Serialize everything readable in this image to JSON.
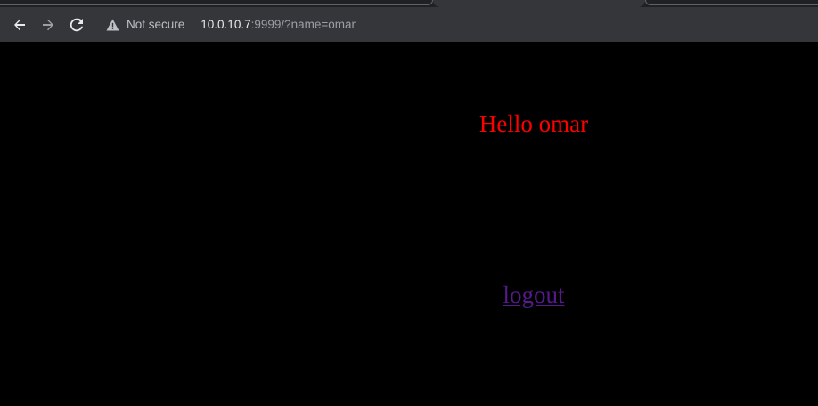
{
  "browser": {
    "security_label": "Not secure",
    "url_host": "10.0.10.7",
    "url_rest": ":9999/?name=omar",
    "icons": [
      "back-arrow-icon",
      "forward-arrow-icon",
      "reload-icon",
      "warning-icon"
    ]
  },
  "page": {
    "greeting": "Hello omar",
    "logout_label": "logout",
    "colors": {
      "background": "#000000",
      "greeting": "#ff0000",
      "link_visited": "#551a8b"
    }
  }
}
